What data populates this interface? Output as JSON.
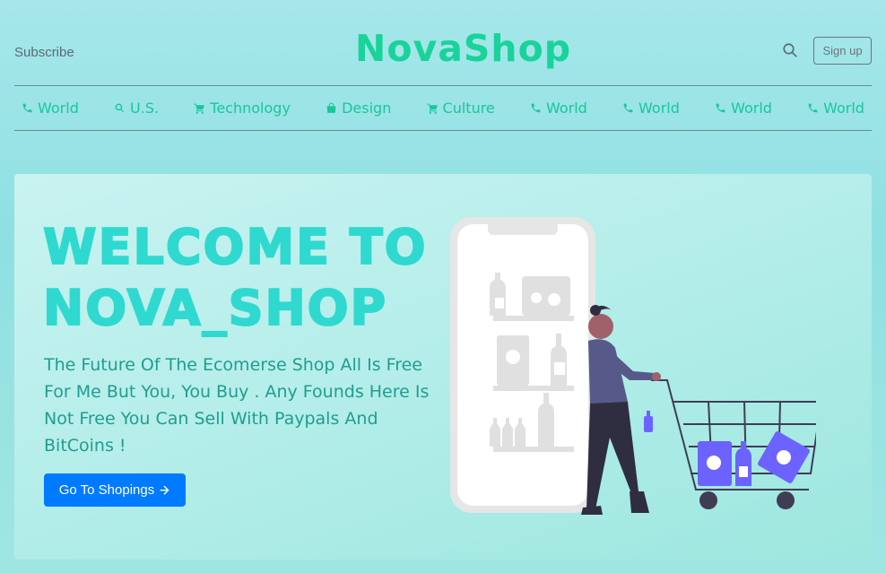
{
  "header": {
    "subscribe_label": "Subscribe",
    "brand": "NovaShop",
    "signup_label": "Sign up",
    "search_icon": "search-icon"
  },
  "nav": {
    "items": [
      {
        "label": "World",
        "icon": "phone-icon"
      },
      {
        "label": "U.S.",
        "icon": "search-icon"
      },
      {
        "label": "Technology",
        "icon": "cart-icon"
      },
      {
        "label": "Design",
        "icon": "shopping-bag-icon"
      },
      {
        "label": "Culture",
        "icon": "cart-icon"
      },
      {
        "label": "World",
        "icon": "phone-icon"
      },
      {
        "label": "World",
        "icon": "phone-icon"
      },
      {
        "label": "World",
        "icon": "phone-icon"
      },
      {
        "label": "World",
        "icon": "phone-icon"
      }
    ]
  },
  "hero": {
    "title": "WELCOME TO NOVA_SHOP",
    "text": "The Future Of The Ecomerse Shop All Is Free For Me But You, You Buy . Any Founds Here Is Not Free You Can Sell With Paypals And BitCoins !",
    "cta_label": "Go To Shopings",
    "cta_icon": "arrow-right-icon",
    "illustration": "shopping-cart-woman-illustration"
  },
  "colors": {
    "brand": "#19d39a",
    "nav": "#19c79a",
    "title": "#2fd9cf",
    "cta": "#007bff",
    "illustration_accent": "#6c63ff"
  }
}
